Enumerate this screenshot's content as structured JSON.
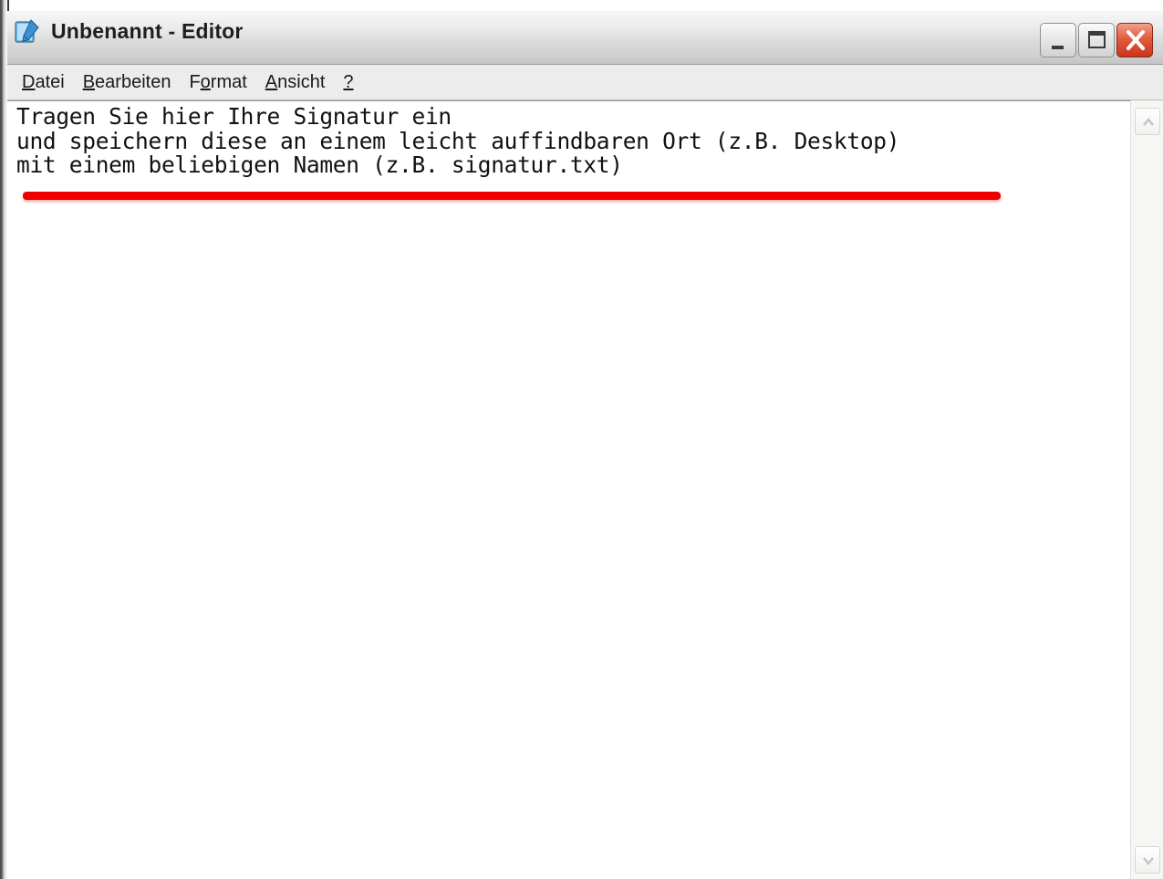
{
  "window": {
    "title": "Unbenannt - Editor",
    "icon": "notepad-icon"
  },
  "caption_buttons": {
    "minimize_icon": "minimize-icon",
    "maximize_icon": "maximize-icon",
    "close_icon": "close-icon"
  },
  "menu": {
    "items": [
      {
        "accel": "D",
        "rest": "atei"
      },
      {
        "accel": "B",
        "rest": "earbeiten"
      },
      {
        "pre": "F",
        "accel": "o",
        "rest": "rmat"
      },
      {
        "accel": "A",
        "rest": "nsicht"
      },
      {
        "accel": "?",
        "rest": ""
      }
    ]
  },
  "editor": {
    "lines": [
      "Tragen Sie hier Ihre Signatur ein",
      "und speichern diese an einem leicht auffindbaren Ort (z.B. Desktop)",
      "mit einem beliebigen Namen (z.B. signatur.txt)"
    ],
    "highlight_color": "#ee0000"
  },
  "colors": {
    "close_button": "#e35b3f",
    "titlebar": "#dadada",
    "menubar": "#ececec"
  }
}
